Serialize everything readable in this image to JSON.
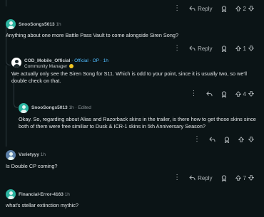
{
  "comments": [
    {
      "author": "",
      "time": "",
      "text": "",
      "votes": "2"
    },
    {
      "author": "SnooSongs5013",
      "time": "1h",
      "text": "Anything about one more Battle Pass Vault to come alongside Siren Song?",
      "votes": "1"
    },
    {
      "author": "COD_Mobile_Official",
      "official_label": "· Official · OP · 1h",
      "flair": "Community Manager",
      "text": "We actually only see the Siren Song for S11. Which is odd to your point, since it is usually two, so we'll double check on that.",
      "votes": "4"
    },
    {
      "author": "SnooSongs5013",
      "time": "1h · Edited",
      "text": "Okay. So, regarding about Alias and Razorback skins in the trailer, is there how to get those skins since both of them were free similiar to Dusk & ICR-1 skins in 5th Anniversary Season?",
      "votes": ""
    },
    {
      "author": "Vxrietyyy",
      "time": "1h",
      "text": "Is Double CP coming?",
      "votes": "7"
    },
    {
      "author": "Financial-Error-4163",
      "time": "1h",
      "text": "what's stellar extinction mythic?",
      "votes": ""
    }
  ],
  "actions": {
    "reply_label": "Reply",
    "more_label": "⋮"
  },
  "colors": {
    "background": "#0b1416",
    "avatar": "#2bb3a0",
    "official": "#4fbcff"
  },
  "icons": [
    "share-icon",
    "upvote-icon",
    "downvote-icon",
    "overflow-icon",
    "reply-icon",
    "award-icon"
  ]
}
